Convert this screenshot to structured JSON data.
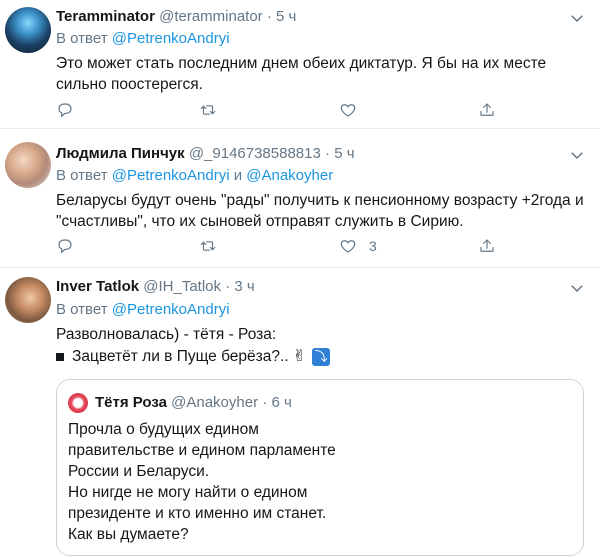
{
  "tweets": [
    {
      "name": "Teramminator",
      "handle": "@teramminator",
      "sep": "·",
      "time": "5 ч",
      "reply_prefix": "В ответ",
      "reply_mentions": [
        "@PetrenkoAndryi"
      ],
      "text": "Это может стать последним днем обеих диктатур. Я бы на их месте сильно поостерегся.",
      "likes": ""
    },
    {
      "name": "Людмила Пинчук",
      "handle": "@_9146738588813",
      "sep": "·",
      "time": "5 ч",
      "reply_prefix": "В ответ",
      "reply_mentions": [
        "@PetrenkoAndryi",
        "@Anakoyher"
      ],
      "reply_joiner": "и",
      "text": "Беларусы будут очень \"рады\" получить к пенсионному возрасту +2года и \"счастливы\", что их сыновей отправят служить в Сирию.",
      "likes": "3"
    },
    {
      "name": "Inver Tatlok",
      "handle": "@IH_Tatlok",
      "sep": "·",
      "time": "3 ч",
      "reply_prefix": "В ответ",
      "reply_mentions": [
        "@PetrenkoAndryi"
      ],
      "text_line1": "Разволновалась) - тётя - Роза:",
      "text_line2": "Зацветёт ли в Пуще берёза?.."
    }
  ],
  "quote": {
    "name": "Тётя Роза",
    "handle": "@Anakoyher",
    "sep": "·",
    "time": "6 ч",
    "text": "Прочла о будущих едином\nправительстве и едином парламенте\nРоссии и Беларуси.\nНо нигде не могу найти о едином\nпрезиденте и кто именно им станет.\nКак вы думаете?"
  },
  "icons": {
    "reply": "reply-icon",
    "retweet": "retweet-icon",
    "like": "heart-icon",
    "share": "share-icon",
    "more": "chevron-down-icon"
  },
  "colors": {
    "link": "#1b95e0",
    "secondary": "#657786",
    "divider": "#e6ecf0"
  }
}
